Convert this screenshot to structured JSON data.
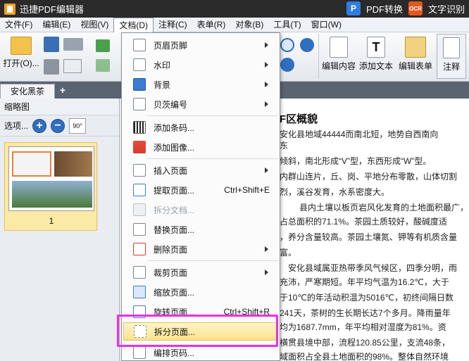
{
  "window": {
    "title": "迅捷PDF编辑器",
    "pdf_convert": "PDF转换",
    "ocr_badge": "OCR",
    "text_recognize": "文字识别"
  },
  "menubar": [
    "文件(F)",
    "编辑(E)",
    "视图(V)",
    "文档(D)",
    "注释(C)",
    "表单(R)",
    "对象(B)",
    "工具(T)",
    "窗口(W)"
  ],
  "ribbon": {
    "open": "打开(O)...",
    "edit_content": "编辑内容",
    "add_text": "添加文本",
    "edit_form": "编辑表单",
    "annotate": "注释"
  },
  "tabs": {
    "doc": "安化黑茶",
    "add": "+"
  },
  "left_panel": {
    "title": "缩略图",
    "options": "选项...",
    "rotate": "90°",
    "page_num": "1"
  },
  "document": {
    "title": "F区概貌",
    "lines": [
      "安化县地域44444而南北短，地势自西南向",
      "东",
      "倾斜，南北形成“V”型，东西形成“W”型。",
      "内群山连片，丘、岗、平地分布零散，山体切割",
      "烈，溪谷发育，水系密度大。",
      "县内土壤以板页岩风化发育的土地面积最广，",
      "占总面积的71.1%。茶园土质较好，酸碱度适",
      "，养分含量较高。茶园土壤氮、钾等有机质含量",
      "富。",
      "安化县域属亚热带季风气候区，四季分明，雨",
      "充沛，严寒期短。年平均气温为16.2℃，大于",
      "于10℃的年活动积温为5016℃，初终间隔日数",
      "241天，茶树的生长期长达7个多月。降雨量年",
      "均为1687.7mm，年平均相对湿度为81%。资",
      "横贯县境中部，流程120.85公里，支流48条，",
      "域面积占全县土地面积的98%。整体自然环境"
    ]
  },
  "dropdown": [
    {
      "label": "页眉页脚",
      "arrow": true
    },
    {
      "label": "水印",
      "arrow": true
    },
    {
      "label": "背景",
      "arrow": true
    },
    {
      "label": "贝茨编号",
      "arrow": true
    },
    {
      "label": "添加条码...",
      "arrow": false
    },
    {
      "label": "添加图像...",
      "arrow": false
    },
    {
      "label": "插入页面",
      "arrow": true
    },
    {
      "label": "提取页面...",
      "shortcut": "Ctrl+Shift+E"
    },
    {
      "label": "拆分文档...",
      "disabled": true
    },
    {
      "label": "替换页面...",
      "arrow": false
    },
    {
      "label": "删除页面",
      "arrow": true
    },
    {
      "label": "裁剪页面",
      "arrow": true
    },
    {
      "label": "缩放页面...",
      "arrow": false
    },
    {
      "label": "旋转页面...",
      "shortcut": "Ctrl+Shift+R"
    },
    {
      "label": "拆分页面...",
      "highlighted": true
    },
    {
      "label": "编排页码..."
    }
  ]
}
